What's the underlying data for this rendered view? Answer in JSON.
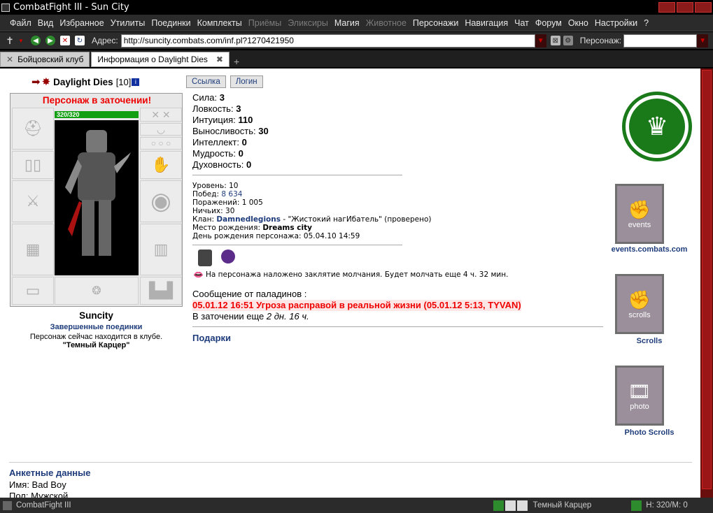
{
  "window": {
    "title": "CombatFight III - Sun City"
  },
  "menu": [
    "Файл",
    "Вид",
    "Избранное",
    "Утилиты",
    "Поединки",
    "Комплекты",
    "Приёмы",
    "Эликсиры",
    "Магия",
    "Животное",
    "Персонажи",
    "Навигация",
    "Чат",
    "Форум",
    "Окно",
    "Настройки",
    "?"
  ],
  "menu_dim": [
    6,
    7,
    9
  ],
  "address": {
    "label": "Адрес:",
    "value": "http://suncity.combats.com/inf.pl?1270421950",
    "character_label": "Персонаж:"
  },
  "tabs": [
    {
      "label": "Бойцовский клуб"
    },
    {
      "label": "Информация о Daylight Dies"
    }
  ],
  "character": {
    "name": "Daylight Dies",
    "level": "[10]",
    "prison_status": "Персонаж в заточении!",
    "hp": "320/320",
    "city": "Suncity",
    "fights_link": "Завершенные поединки",
    "location_text": "Персонаж сейчас находится в клубе.",
    "location_name": "\"Темный Карцер\""
  },
  "buttons": {
    "link": "Ссылка",
    "login": "Логин"
  },
  "stats": [
    {
      "label": "Сила:",
      "value": "3"
    },
    {
      "label": "Ловкость:",
      "value": "3"
    },
    {
      "label": "Интуиция:",
      "value": "110"
    },
    {
      "label": "Выносливость:",
      "value": "30"
    },
    {
      "label": "Интеллект:",
      "value": "0"
    },
    {
      "label": "Мудрость:",
      "value": "0"
    },
    {
      "label": "Духовность:",
      "value": "0"
    }
  ],
  "details": {
    "level": "Уровень: 10",
    "wins_label": "Побед:",
    "wins": "8 634",
    "losses": "Поражений: 1 005",
    "draws": "Ничьих: 30",
    "clan_label": "Клан:",
    "clan": "Damnedlegions",
    "clan_rest": " - \"Жистокий нагИбатель\" (проверено)",
    "birthplace_label": "Место рождения:",
    "birthplace": "Dreams city",
    "birthday": "День рождения персонажа: 05.04.10 14:59"
  },
  "silence": "На персонажа наложено заклятие молчания. Будет молчать еще 4 ч. 32 мин.",
  "paladin": {
    "header": "Сообщение от паладинов :",
    "message": "05.01.12 16:51 Угроза расправой в реальной жизни (05.01.12 5:13, TYVAN)",
    "prison_prefix": "В заточении еще",
    "prison_time": "2 дн. 16 ч."
  },
  "gifts": "Подарки",
  "sidebar": {
    "events_banner": "events",
    "events": "events.combats.com",
    "scrolls_banner": "scrolls",
    "scrolls": "Scrolls",
    "photo_banner": "photo",
    "photo": "Photo Scrolls"
  },
  "anketa": {
    "header": "Анкетные данные",
    "name": "Имя: Bad Boy",
    "gender": "Пол: Мужской"
  },
  "status": {
    "left": "CombatFight III",
    "location": "Темный Карцер",
    "hp": "H: 320/M: 0"
  }
}
